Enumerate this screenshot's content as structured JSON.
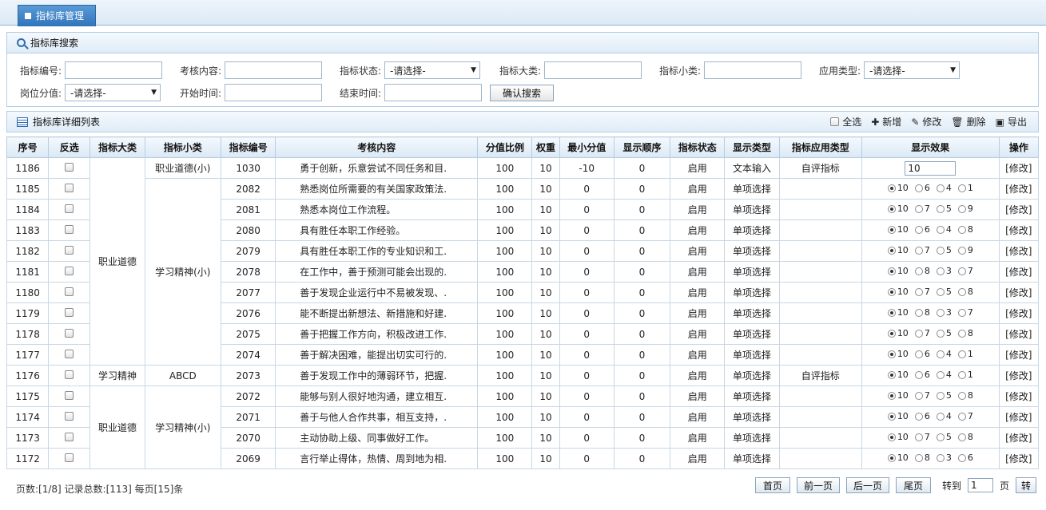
{
  "tab": {
    "label": "指标库管理"
  },
  "search": {
    "title": "指标库搜索",
    "code_label": "指标编号:",
    "content_label": "考核内容:",
    "status_label": "指标状态:",
    "status_value": "-请选择-",
    "major_label": "指标大类:",
    "minor_label": "指标小类:",
    "apptype_label": "应用类型:",
    "apptype_value": "-请选择-",
    "post_label": "岗位分值:",
    "post_value": "-请选择-",
    "start_label": "开始时间:",
    "end_label": "结束时间:",
    "submit": "确认搜索"
  },
  "list": {
    "title": "指标库详细列表",
    "select_all": "全选",
    "add": "新增",
    "edit": "修改",
    "delete": "删除",
    "export": "导出"
  },
  "columns": [
    "序号",
    "反选",
    "指标大类",
    "指标小类",
    "指标编号",
    "考核内容",
    "分值比例",
    "权重",
    "最小分值",
    "显示顺序",
    "指标状态",
    "显示类型",
    "指标应用类型",
    "显示效果",
    "操作"
  ],
  "groups": {
    "g1": "职业道德",
    "g1_sub_a": "职业道德(小)",
    "g1_sub_b": "学习精神(小)",
    "g2": "学习精神",
    "g2_sub": "ABCD",
    "g3": "职业道德",
    "g3_sub": "学习精神(小)"
  },
  "rows": [
    {
      "id": "1186",
      "code": "1030",
      "content": "勇于创新，乐意尝试不同任务和目.",
      "ratio": "100",
      "weight": "10",
      "min": "-10",
      "order": "0",
      "status": "启用",
      "dtype": "文本输入",
      "apptype": "自评指标",
      "effect": "10",
      "op": "[修改]"
    },
    {
      "id": "1185",
      "code": "2082",
      "content": "熟悉岗位所需要的有关国家政策法.",
      "ratio": "100",
      "weight": "10",
      "min": "0",
      "order": "0",
      "status": "启用",
      "dtype": "单项选择",
      "apptype": "",
      "opts": [
        "10",
        "6",
        "4",
        "1"
      ],
      "op": "[修改]"
    },
    {
      "id": "1184",
      "code": "2081",
      "content": "熟悉本岗位工作流程。",
      "ratio": "100",
      "weight": "10",
      "min": "0",
      "order": "0",
      "status": "启用",
      "dtype": "单项选择",
      "apptype": "",
      "opts": [
        "10",
        "7",
        "5",
        "9"
      ],
      "op": "[修改]"
    },
    {
      "id": "1183",
      "code": "2080",
      "content": "具有胜任本职工作经验。",
      "ratio": "100",
      "weight": "10",
      "min": "0",
      "order": "0",
      "status": "启用",
      "dtype": "单项选择",
      "apptype": "",
      "opts": [
        "10",
        "6",
        "4",
        "8"
      ],
      "op": "[修改]"
    },
    {
      "id": "1182",
      "code": "2079",
      "content": "具有胜任本职工作的专业知识和工.",
      "ratio": "100",
      "weight": "10",
      "min": "0",
      "order": "0",
      "status": "启用",
      "dtype": "单项选择",
      "apptype": "",
      "opts": [
        "10",
        "7",
        "5",
        "9"
      ],
      "op": "[修改]"
    },
    {
      "id": "1181",
      "code": "2078",
      "content": "在工作中，善于预测可能会出现的.",
      "ratio": "100",
      "weight": "10",
      "min": "0",
      "order": "0",
      "status": "启用",
      "dtype": "单项选择",
      "apptype": "",
      "opts": [
        "10",
        "8",
        "3",
        "7"
      ],
      "op": "[修改]"
    },
    {
      "id": "1180",
      "code": "2077",
      "content": "善于发现企业运行中不易被发现、.",
      "ratio": "100",
      "weight": "10",
      "min": "0",
      "order": "0",
      "status": "启用",
      "dtype": "单项选择",
      "apptype": "",
      "opts": [
        "10",
        "7",
        "5",
        "8"
      ],
      "op": "[修改]"
    },
    {
      "id": "1179",
      "code": "2076",
      "content": "能不断提出新想法、新措施和好建.",
      "ratio": "100",
      "weight": "10",
      "min": "0",
      "order": "0",
      "status": "启用",
      "dtype": "单项选择",
      "apptype": "",
      "opts": [
        "10",
        "8",
        "3",
        "7"
      ],
      "op": "[修改]"
    },
    {
      "id": "1178",
      "code": "2075",
      "content": "善于把握工作方向，积极改进工作.",
      "ratio": "100",
      "weight": "10",
      "min": "0",
      "order": "0",
      "status": "启用",
      "dtype": "单项选择",
      "apptype": "",
      "opts": [
        "10",
        "7",
        "5",
        "8"
      ],
      "op": "[修改]"
    },
    {
      "id": "1177",
      "code": "2074",
      "content": "善于解决困难，能提出切实可行的.",
      "ratio": "100",
      "weight": "10",
      "min": "0",
      "order": "0",
      "status": "启用",
      "dtype": "单项选择",
      "apptype": "",
      "opts": [
        "10",
        "6",
        "4",
        "1"
      ],
      "op": "[修改]"
    },
    {
      "id": "1176",
      "code": "2073",
      "content": "善于发现工作中的薄弱环节，把握.",
      "ratio": "100",
      "weight": "10",
      "min": "0",
      "order": "0",
      "status": "启用",
      "dtype": "单项选择",
      "apptype": "自评指标",
      "opts": [
        "10",
        "6",
        "4",
        "1"
      ],
      "op": "[修改]"
    },
    {
      "id": "1175",
      "code": "2072",
      "content": "能够与别人很好地沟通，建立相互.",
      "ratio": "100",
      "weight": "10",
      "min": "0",
      "order": "0",
      "status": "启用",
      "dtype": "单项选择",
      "apptype": "",
      "opts": [
        "10",
        "7",
        "5",
        "8"
      ],
      "op": "[修改]"
    },
    {
      "id": "1174",
      "code": "2071",
      "content": "善于与他人合作共事，相互支持，.",
      "ratio": "100",
      "weight": "10",
      "min": "0",
      "order": "0",
      "status": "启用",
      "dtype": "单项选择",
      "apptype": "",
      "opts": [
        "10",
        "6",
        "4",
        "7"
      ],
      "op": "[修改]"
    },
    {
      "id": "1173",
      "code": "2070",
      "content": "主动协助上级、同事做好工作。",
      "ratio": "100",
      "weight": "10",
      "min": "0",
      "order": "0",
      "status": "启用",
      "dtype": "单项选择",
      "apptype": "",
      "opts": [
        "10",
        "7",
        "5",
        "8"
      ],
      "op": "[修改]"
    },
    {
      "id": "1172",
      "code": "2069",
      "content": "言行举止得体，热情、周到地为相.",
      "ratio": "100",
      "weight": "10",
      "min": "0",
      "order": "0",
      "status": "启用",
      "dtype": "单项选择",
      "apptype": "",
      "opts": [
        "10",
        "8",
        "3",
        "6"
      ],
      "op": "[修改]"
    }
  ],
  "pager": {
    "info": "页数:[1/8] 记录总数:[113] 每页[15]条",
    "first": "首页",
    "prev": "前一页",
    "next": "后一页",
    "last": "尾页",
    "goto_label": "转到",
    "goto_value": "1",
    "page_unit": "页",
    "go": "转"
  }
}
